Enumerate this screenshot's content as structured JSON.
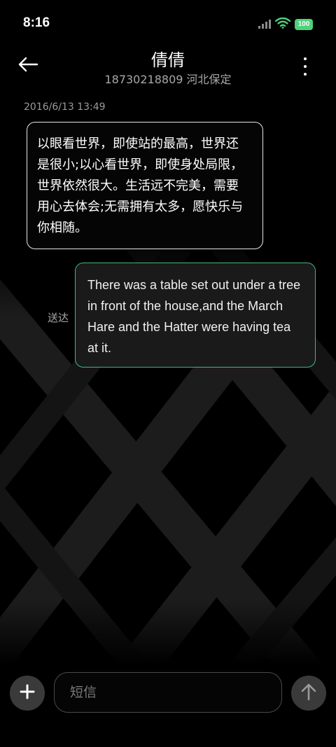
{
  "status_bar": {
    "time": "8:16",
    "battery": "100"
  },
  "header": {
    "contact_name": "倩倩",
    "contact_detail": "18730218809 河北保定"
  },
  "messages": [
    {
      "timestamp": "2016/6/13 13:49",
      "direction": "incoming",
      "text": "以眼看世界，即使站的最高，世界还是很小;以心看世界，即使身处局限，世界依然很大。生活远不完美，需要用心去体会;无需拥有太多，愿快乐与你相随。"
    },
    {
      "direction": "outgoing",
      "status": "送达",
      "text": "There was a table set out under a tree in front of the house,and the March Hare and the Hatter were having tea at it."
    }
  ],
  "composer": {
    "placeholder": "短信"
  },
  "icons": {
    "back": "arrow-left-icon",
    "more": "more-vertical-icon",
    "add": "plus-icon",
    "send": "arrow-up-icon",
    "signal": "signal-icon",
    "wifi": "wifi-icon"
  },
  "colors": {
    "outgoing_border": "#3fb981",
    "battery": "#4fd17a",
    "background": "#000000"
  }
}
